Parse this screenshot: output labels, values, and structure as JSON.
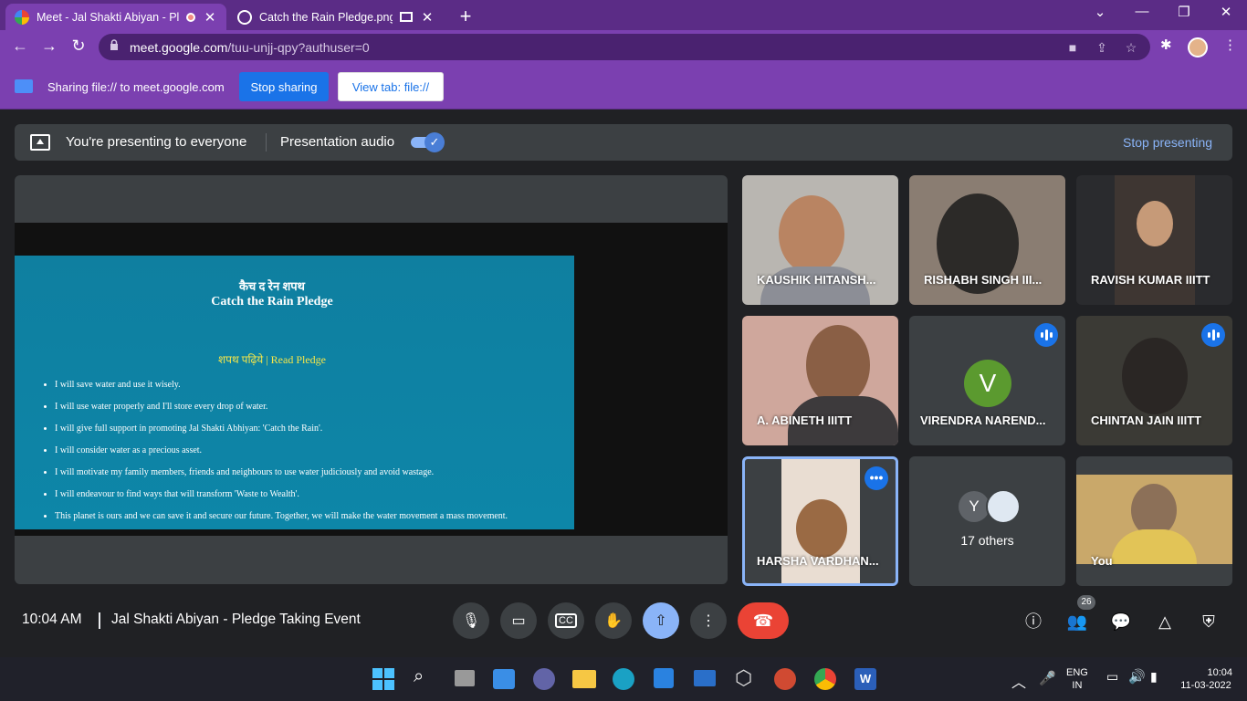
{
  "browser": {
    "tabs": [
      {
        "title": "Meet - Jal Shakti Abiyan - Ple",
        "active": true
      },
      {
        "title": "Catch the Rain Pledge.png (5",
        "active": false
      }
    ],
    "url_domain": "meet.google.com",
    "url_path": "/tuu-unjj-qpy?authuser=0"
  },
  "sharing": {
    "text": "Sharing file:// to meet.google.com",
    "stop_label": "Stop sharing",
    "view_label": "View tab: file://"
  },
  "presenting": {
    "status": "You're presenting to everyone",
    "audio_label": "Presentation audio",
    "audio_on": true,
    "stop_label": "Stop presenting"
  },
  "slide": {
    "title_hindi": "कैच द रेन शपथ",
    "title": "Catch the Rain Pledge",
    "subtitle": "शपथ पढ़िये | Read Pledge",
    "points": [
      "I will save water and use it wisely.",
      "I will use water properly and I'll store every drop of water.",
      "I will give full support in promoting Jal Shakti Abhiyan: 'Catch the Rain'.",
      "I will consider water as a precious asset.",
      "I will motivate my family members, friends and neighbours to use water judiciously and avoid wastage.",
      "I will endeavour to find ways that will transform 'Waste to Wealth'.",
      "This planet is ours and we can save it and secure our future. Together, we will make the water movement a mass movement."
    ]
  },
  "participants": [
    {
      "name": "KAUSHIK HITANSH..."
    },
    {
      "name": "RISHABH SINGH III..."
    },
    {
      "name": "RAVISH KUMAR IIITT"
    },
    {
      "name": "A. ABINETH IIITT"
    },
    {
      "name": "VIRENDRA NAREND...",
      "initial": "V"
    },
    {
      "name": "CHINTAN JAIN IIITT"
    },
    {
      "name": "HARSHA VARDHAN..."
    },
    {
      "name": "17 others",
      "initial": "Y"
    },
    {
      "name": "You"
    }
  ],
  "meeting": {
    "time": "10:04 AM",
    "name": "Jal Shakti Abiyan - Pledge Taking Event",
    "people_count": "26"
  },
  "taskbar": {
    "lang1": "ENG",
    "lang2": "IN",
    "time": "10:04",
    "date": "11-03-2022"
  },
  "colors": {
    "tab_bar": "#5b2c86",
    "chrome": "#7b40b0",
    "meet_bg": "#202124",
    "accent": "#1a73e8",
    "end_call": "#ea4335"
  }
}
